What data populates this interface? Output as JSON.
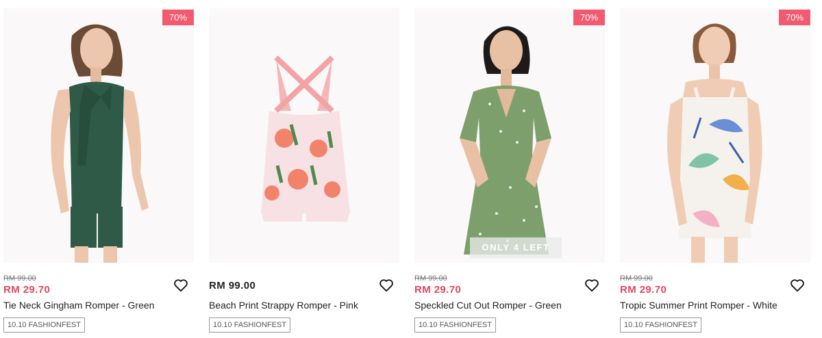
{
  "colors": {
    "badge": "#f25a70",
    "sale_price": "#e2475f",
    "image_bg": "#fbf8f9"
  },
  "products": [
    {
      "discount": "70%",
      "old_price": "RM 99.00",
      "price": "RM 29.70",
      "name": "Tie Neck Gingham Romper - Green",
      "tag": "10.10 FASHIONFEST",
      "wishlist_icon": "heart-outline-icon"
    },
    {
      "price": "RM 99.00",
      "name": "Beach Print Strappy Romper - Pink",
      "tag": "10.10 FASHIONFEST",
      "wishlist_icon": "heart-outline-icon"
    },
    {
      "discount": "70%",
      "stock_label": "ONLY 4 LEFT",
      "old_price": "RM 99.00",
      "price": "RM 29.70",
      "name": "Speckled Cut Out Romper - Green",
      "tag": "10.10 FASHIONFEST",
      "wishlist_icon": "heart-outline-icon"
    },
    {
      "discount": "70%",
      "old_price": "RM 99.00",
      "price": "RM 29.70",
      "name": "Tropic Summer Print Romper - White",
      "tag": "10.10 FASHIONFEST",
      "wishlist_icon": "heart-outline-icon"
    }
  ]
}
